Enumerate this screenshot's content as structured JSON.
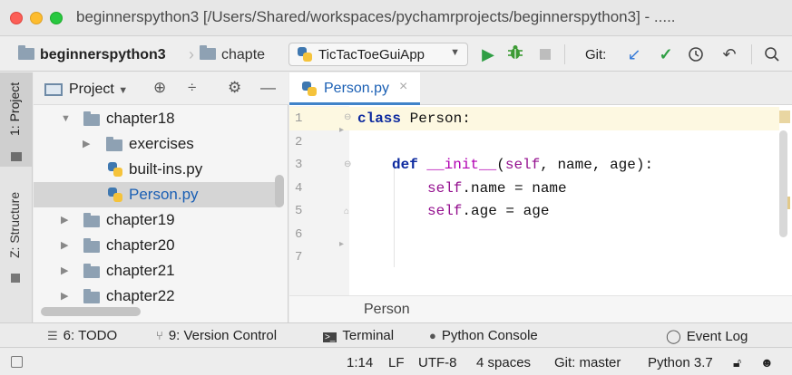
{
  "window": {
    "title": "beginnerspython3 [/Users/Shared/workspaces/pychamrprojects/beginnerspython3] - ....."
  },
  "navbar": {
    "project_crumb": "beginnerspython3",
    "folder_crumb": "chapte",
    "run_config": "TicTacToeGuiApp",
    "git_label": "Git:",
    "icons": [
      "run-icon",
      "debug-icon",
      "stop-icon",
      "git-update-icon",
      "git-commit-icon",
      "history-icon",
      "revert-icon",
      "search-icon"
    ],
    "colors": {
      "run": "#2f9e44",
      "debug": "#3d9b35",
      "git_update": "#3b7dd8",
      "git_commit": "#2f9e44"
    }
  },
  "left_strip": {
    "tabs": [
      "1: Project",
      "Z: Structure"
    ]
  },
  "project_panel": {
    "title": "Project",
    "tree": [
      {
        "label": "chapter18",
        "type": "folder",
        "expanded": true,
        "depth": 1
      },
      {
        "label": "exercises",
        "type": "folder",
        "expanded": false,
        "depth": 2
      },
      {
        "label": "built-ins.py",
        "type": "python-file",
        "depth": 2
      },
      {
        "label": "Person.py",
        "type": "python-file",
        "depth": 2,
        "selected": true
      },
      {
        "label": "chapter19",
        "type": "folder",
        "expanded": false,
        "depth": 1
      },
      {
        "label": "chapter20",
        "type": "folder",
        "expanded": false,
        "depth": 1
      },
      {
        "label": "chapter21",
        "type": "folder",
        "expanded": false,
        "depth": 1
      },
      {
        "label": "chapter22",
        "type": "folder",
        "expanded": false,
        "depth": 1
      }
    ]
  },
  "editor": {
    "tab_label": "Person.py",
    "line_numbers": [
      "1",
      "2",
      "3",
      "4",
      "5",
      "6",
      "7"
    ],
    "code": {
      "l1_kw": "class",
      "l1_rest": " Person:",
      "l3_kw": "def",
      "l3_magic": "__init__",
      "l3_open": "(",
      "l3_self": "self",
      "l3_rest": ", name, age):",
      "l4_self": "self",
      "l4_rest": ".name = name",
      "l5_self": "self",
      "l5_rest": ".age = age"
    },
    "breadcrumb": "Person",
    "current_line": 1
  },
  "tool_windows": {
    "todo": "6: TODO",
    "todo_key": "6",
    "version_control": "9: Version Control",
    "terminal": "Terminal",
    "python_console": "Python Console",
    "event_log": "Event Log"
  },
  "status": {
    "position": "1:14",
    "line_sep": "LF",
    "encoding": "UTF-8",
    "indent": "4 spaces",
    "git_branch": "Git: master",
    "interpreter": "Python 3.7"
  }
}
